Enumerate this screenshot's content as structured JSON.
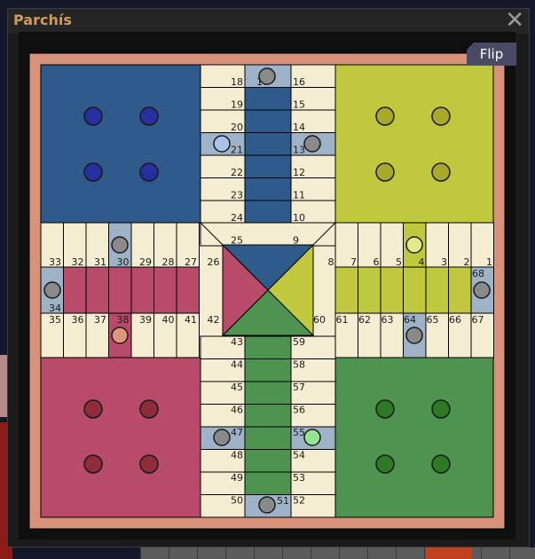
{
  "window": {
    "title": "Parchís",
    "close_label": "✕"
  },
  "board": {
    "flip_label": "Flip"
  },
  "colors": {
    "blue": "#2e5a8c",
    "yellow": "#c0c83e",
    "red": "#b84a6a",
    "green": "#4f9350",
    "cream": "#f5edd2",
    "border": "#d9927a",
    "safe": "#9fb3c8"
  },
  "pieces": {
    "home_blue": 4,
    "home_yellow": 4,
    "home_red": 4,
    "home_green": 4,
    "on_track": [
      {
        "square": "17",
        "color": "gray"
      },
      {
        "square": "21",
        "color": "lightblue"
      },
      {
        "square": "13",
        "color": "gray"
      },
      {
        "square": "30",
        "color": "gray"
      },
      {
        "square": "34",
        "color": "gray"
      },
      {
        "square": "38",
        "color": "salmon"
      },
      {
        "square": "4",
        "color": "lightyellow"
      },
      {
        "square": "68",
        "color": "gray"
      },
      {
        "square": "64",
        "color": "gray"
      },
      {
        "square": "47",
        "color": "gray"
      },
      {
        "square": "55",
        "color": "lightgreen"
      },
      {
        "square": "51",
        "color": "gray"
      }
    ]
  },
  "labels": {
    "top_left": [
      "18",
      "19",
      "20",
      "21",
      "22",
      "23",
      "24",
      "25"
    ],
    "top_right": [
      "16",
      "15",
      "14",
      "13",
      "12",
      "11",
      "10",
      "9"
    ],
    "top_17": "17",
    "left_top": [
      "33",
      "32",
      "31",
      "30",
      "29",
      "28",
      "27",
      "26"
    ],
    "left_bot": [
      "35",
      "36",
      "37",
      "38",
      "39",
      "40",
      "41",
      "42"
    ],
    "left_34": "34",
    "right_top": [
      "8",
      "7",
      "6",
      "5",
      "4",
      "3",
      "2",
      "1"
    ],
    "right_bot": [
      "60",
      "61",
      "62",
      "63",
      "64",
      "65",
      "66",
      "67"
    ],
    "right_68": "68",
    "bot_left": [
      "43",
      "44",
      "45",
      "46",
      "47",
      "48",
      "49",
      "50"
    ],
    "bot_right": [
      "59",
      "58",
      "57",
      "56",
      "55",
      "54",
      "53",
      "52"
    ],
    "bot_51": "51"
  }
}
